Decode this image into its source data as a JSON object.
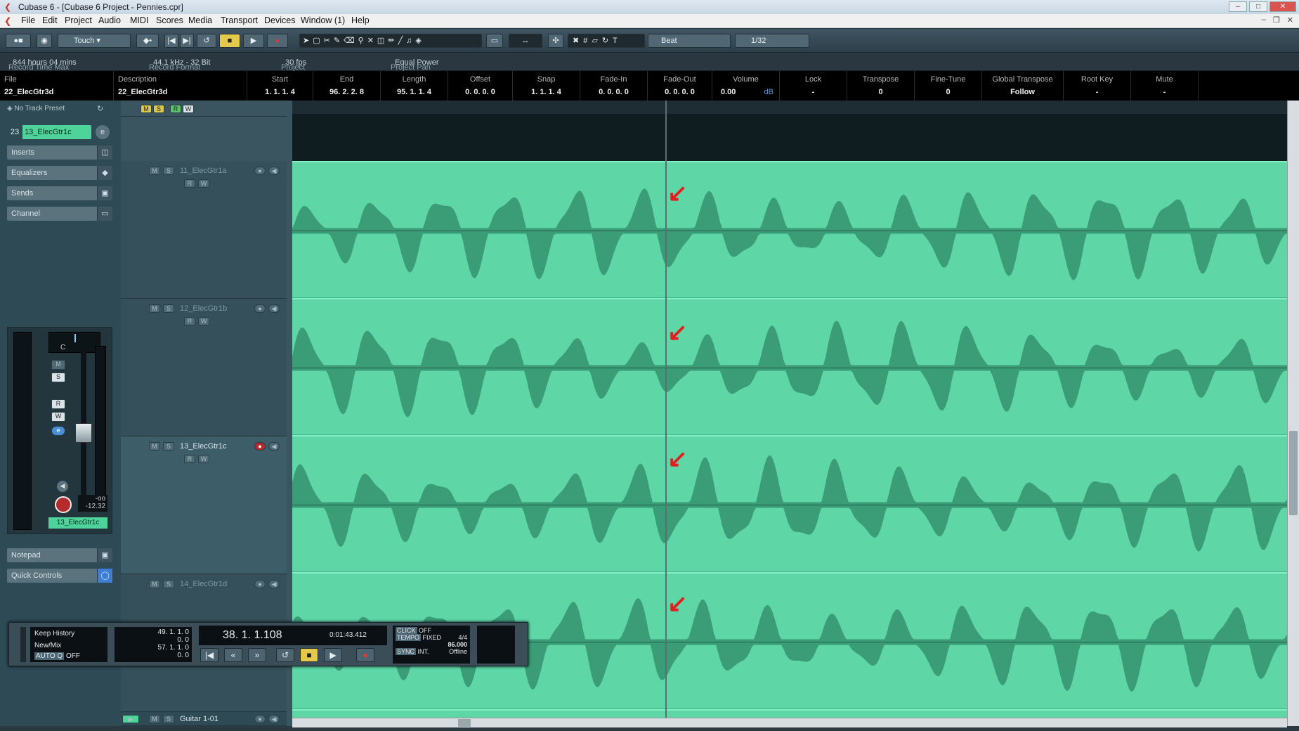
{
  "window": {
    "title": "Cubase 6 - [Cubase 6 Project - Pennies.cpr]"
  },
  "menu": [
    "File",
    "Edit",
    "Project",
    "Audio",
    "MIDI",
    "Scores",
    "Media",
    "Transport",
    "Devices",
    "Window (1)",
    "Help"
  ],
  "toolbar": {
    "automation_mode": "Touch",
    "snap_type": "Beat",
    "quantize": "1/32"
  },
  "infoline": {
    "record_time_max_label": "Record Time Max",
    "record_time_max": "844 hours 04 mins",
    "record_format_label": "Record Format",
    "record_format": "44.1 kHz - 32 Bit",
    "frame_rate_label": "Project Frame Rate",
    "frame_rate": "30 fps",
    "pan_law_label": "Project Pan Law",
    "pan_law": "Equal Power"
  },
  "event_info": {
    "file": {
      "h": "File",
      "v": "22_ElecGtr3d"
    },
    "description": {
      "h": "Description",
      "v": "22_ElecGtr3d"
    },
    "start": {
      "h": "Start",
      "v": "1. 1. 1.   4"
    },
    "end": {
      "h": "End",
      "v": "96. 2. 2.   8"
    },
    "length": {
      "h": "Length",
      "v": "95. 1. 1.   4"
    },
    "offset": {
      "h": "Offset",
      "v": "0. 0. 0.   0"
    },
    "snap": {
      "h": "Snap",
      "v": "1. 1. 1.   4"
    },
    "fade_in": {
      "h": "Fade-In",
      "v": "0. 0. 0.   0"
    },
    "fade_out": {
      "h": "Fade-Out",
      "v": "0. 0. 0.   0"
    },
    "volume": {
      "h": "Volume",
      "v": "0.00",
      "unit": "dB"
    },
    "lock": {
      "h": "Lock",
      "v": "-"
    },
    "transpose": {
      "h": "Transpose",
      "v": "0"
    },
    "fine_tune": {
      "h": "Fine-Tune",
      "v": "0"
    },
    "global_transpose": {
      "h": "Global Transpose",
      "v": "Follow"
    },
    "root_key": {
      "h": "Root Key",
      "v": "-"
    },
    "mute": {
      "h": "Mute",
      "v": "-"
    }
  },
  "inspector": {
    "preset": "No Track Preset",
    "track_number": "23",
    "track_name": "13_ElecGtr1c",
    "sections": [
      "Inserts",
      "Equalizers",
      "Sends",
      "Channel",
      "Notepad",
      "Quick Controls"
    ],
    "pan": "C",
    "meter_peak": "-oo",
    "fader_value": "-12.32",
    "channel_name": "13_ElecGtr1c",
    "buttons": {
      "mute": "M",
      "solo": "S",
      "read": "R",
      "write": "W",
      "edit": "e"
    }
  },
  "tracklist": {
    "header_buttons": [
      "M",
      "S",
      "R",
      "W"
    ],
    "tracks": [
      {
        "name": "11_ElecGtr1a"
      },
      {
        "name": "12_ElecGtr1b"
      },
      {
        "name": "13_ElecGtr1c"
      },
      {
        "name": "14_ElecGtr1d"
      },
      {
        "name": "Guitar 1-01"
      }
    ],
    "track_buttons": {
      "mute": "M",
      "solo": "S",
      "read": "R",
      "write": "W"
    }
  },
  "transport": {
    "keep_history": "Keep History",
    "new_mix": "New/Mix",
    "auto_q": "AUTO Q",
    "auto_q_state": "OFF",
    "left_locator": "49. 1. 1.   0",
    "left_offset": "0.   0",
    "right_locator": "57. 1. 1.   0",
    "right_offset": "0.   0",
    "position_bars": "38. 1. 1.108",
    "position_time": "0:01:43.412",
    "click_label": "CLICK",
    "click_state": "OFF",
    "tempo_label": "TEMPO",
    "tempo_mode": "FIXED",
    "signature": "4/4",
    "tempo": "86.000",
    "sync_label": "SYNC",
    "sync_mode": "INT.",
    "sync_state": "Offline"
  },
  "colors": {
    "event_fill": "#5ed6a6",
    "waveform": "#2f8a68",
    "annotation_arrow": "#e02020"
  }
}
